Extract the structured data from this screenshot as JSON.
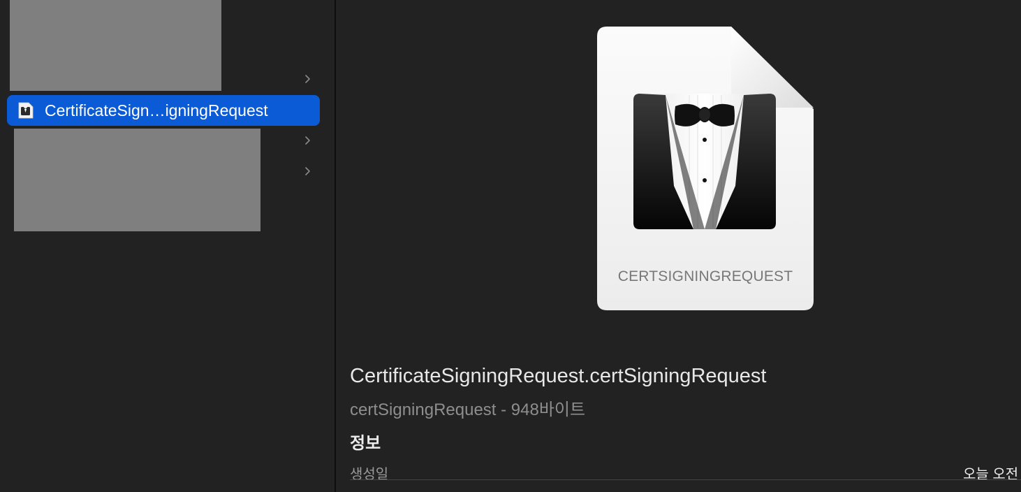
{
  "sidebar": {
    "selected_item": {
      "label": "CertificateSign…igningRequest",
      "icon": "bowtie-doc-icon"
    }
  },
  "preview": {
    "doc_type_label": "CERTSIGNINGREQUEST",
    "file_name": "CertificateSigningRequest.certSigningRequest",
    "file_meta": "certSigningRequest - 948바이트",
    "info_heading": "정보",
    "info_rows": [
      {
        "label": "생성일",
        "value": "오늘 오전"
      }
    ]
  },
  "colors": {
    "background": "#232222",
    "selection": "#0b5ad6",
    "redacted": "#7f7f7f"
  }
}
